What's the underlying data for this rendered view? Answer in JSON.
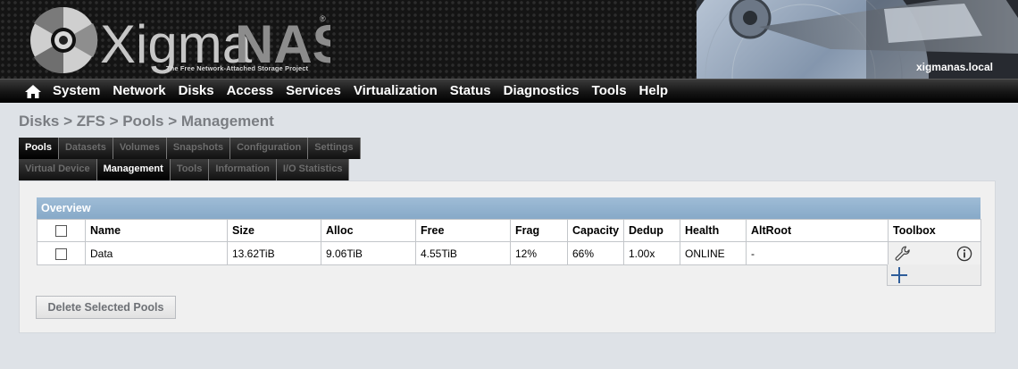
{
  "header": {
    "brand_first": "Xigma",
    "brand_second": "NAS",
    "registered": "®",
    "tagline": "The Free Network-Attached Storage Project",
    "hostname": "xigmanas.local"
  },
  "nav": {
    "home_icon": "home-icon",
    "items": [
      "System",
      "Network",
      "Disks",
      "Access",
      "Services",
      "Virtualization",
      "Status",
      "Diagnostics",
      "Tools",
      "Help"
    ]
  },
  "breadcrumb": "Disks > ZFS > Pools > Management",
  "tabs": {
    "row1": [
      "Pools",
      "Datasets",
      "Volumes",
      "Snapshots",
      "Configuration",
      "Settings"
    ],
    "row1_active": "Pools",
    "row2": [
      "Virtual Device",
      "Management",
      "Tools",
      "Information",
      "I/O Statistics"
    ],
    "row2_active": "Management"
  },
  "overview": {
    "title": "Overview",
    "columns": [
      "Name",
      "Size",
      "Alloc",
      "Free",
      "Frag",
      "Capacity",
      "Dedup",
      "Health",
      "AltRoot",
      "Toolbox"
    ],
    "rows": [
      {
        "name": "Data",
        "size": "13.62TiB",
        "alloc": "9.06TiB",
        "free": "4.55TiB",
        "frag": "12%",
        "capacity": "66%",
        "dedup": "1.00x",
        "health": "ONLINE",
        "altroot": "-"
      }
    ]
  },
  "buttons": {
    "delete_selected": "Delete Selected Pools"
  },
  "colors": {
    "overview_bar": "#8fb0cf",
    "health_online": "#1a1aa0",
    "page_background": "#dee2e7"
  }
}
